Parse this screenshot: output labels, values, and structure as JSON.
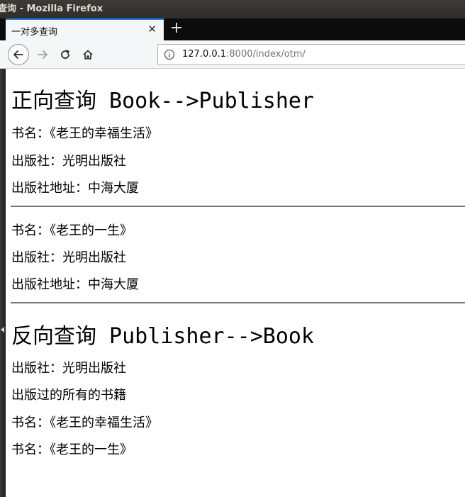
{
  "window": {
    "title": "查询 - Mozilla Firefox"
  },
  "tabs": [
    {
      "title": "一对多查询",
      "active": true
    }
  ],
  "navbar": {
    "url_host": "127.0.0.1",
    "url_rest": ":8000/index/otm/"
  },
  "colors": {
    "tab_accent": "#0a84ff",
    "page_background": "#ffffff",
    "hr_color": "#767676"
  },
  "icons": [
    "back-arrow-icon",
    "forward-arrow-icon",
    "reload-icon",
    "home-icon",
    "info-icon",
    "close-icon",
    "plus-icon"
  ],
  "content": {
    "forward_heading": "正向查询 Book-->Publisher",
    "forward_entries": [
      {
        "book": "书名：《老王的幸福生活》",
        "publisher": "出版社：光明出版社",
        "address": "出版社地址：中海大厦"
      },
      {
        "book": "书名：《老王的一生》",
        "publisher": "出版社：光明出版社",
        "address": "出版社地址：中海大厦"
      }
    ],
    "reverse_heading": "反向查询 Publisher-->Book",
    "reverse_publisher": "出版社：光明出版社",
    "reverse_subheading": "出版过的所有的书籍",
    "reverse_books": [
      "书名：《老王的幸福生活》",
      "书名：《老王的一生》"
    ]
  }
}
